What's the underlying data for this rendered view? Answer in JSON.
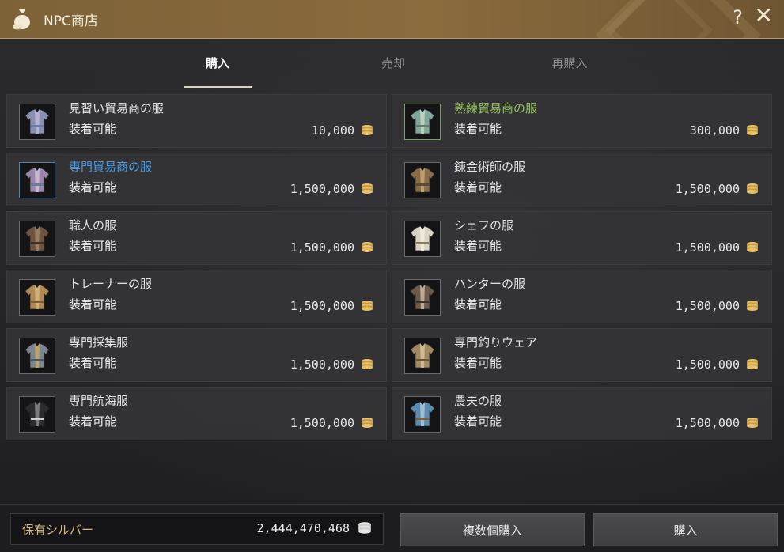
{
  "window": {
    "title": "NPC商店",
    "help_label": "?",
    "close_label": "✕"
  },
  "tabs": [
    {
      "label": "購入",
      "active": true
    },
    {
      "label": "売却",
      "active": false
    },
    {
      "label": "再購入",
      "active": false
    }
  ],
  "items": [
    {
      "name": "見習い貿易商の服",
      "status": "装着可能",
      "price": "10,000",
      "name_color": "default",
      "icon": "clothing-icon"
    },
    {
      "name": "熟練貿易商の服",
      "status": "装着可能",
      "price": "300,000",
      "name_color": "green",
      "icon": "clothing-icon"
    },
    {
      "name": "専門貿易商の服",
      "status": "装着可能",
      "price": "1,500,000",
      "name_color": "blue",
      "icon": "clothing-icon"
    },
    {
      "name": "錬金術師の服",
      "status": "装着可能",
      "price": "1,500,000",
      "name_color": "default",
      "icon": "clothing-icon"
    },
    {
      "name": "職人の服",
      "status": "装着可能",
      "price": "1,500,000",
      "name_color": "default",
      "icon": "clothing-icon"
    },
    {
      "name": "シェフの服",
      "status": "装着可能",
      "price": "1,500,000",
      "name_color": "default",
      "icon": "clothing-icon"
    },
    {
      "name": "トレーナーの服",
      "status": "装着可能",
      "price": "1,500,000",
      "name_color": "default",
      "icon": "clothing-icon"
    },
    {
      "name": "ハンターの服",
      "status": "装着可能",
      "price": "1,500,000",
      "name_color": "default",
      "icon": "clothing-icon"
    },
    {
      "name": "専門採集服",
      "status": "装着可能",
      "price": "1,500,000",
      "name_color": "default",
      "icon": "clothing-icon"
    },
    {
      "name": "専門釣りウェア",
      "status": "装着可能",
      "price": "1,500,000",
      "name_color": "default",
      "icon": "clothing-icon"
    },
    {
      "name": "専門航海服",
      "status": "装着可能",
      "price": "1,500,000",
      "name_color": "default",
      "icon": "clothing-icon"
    },
    {
      "name": "農夫の服",
      "status": "装着可能",
      "price": "1,500,000",
      "name_color": "default",
      "icon": "clothing-icon"
    }
  ],
  "footer": {
    "silver_label": "保有シルバー",
    "silver_value": "2,444,470,468",
    "multi_buy_label": "複数個購入",
    "buy_label": "購入"
  },
  "colors": {
    "accent_gold": "#d7b77a",
    "name_green": "#93c45b",
    "name_blue": "#4a9ee8"
  }
}
